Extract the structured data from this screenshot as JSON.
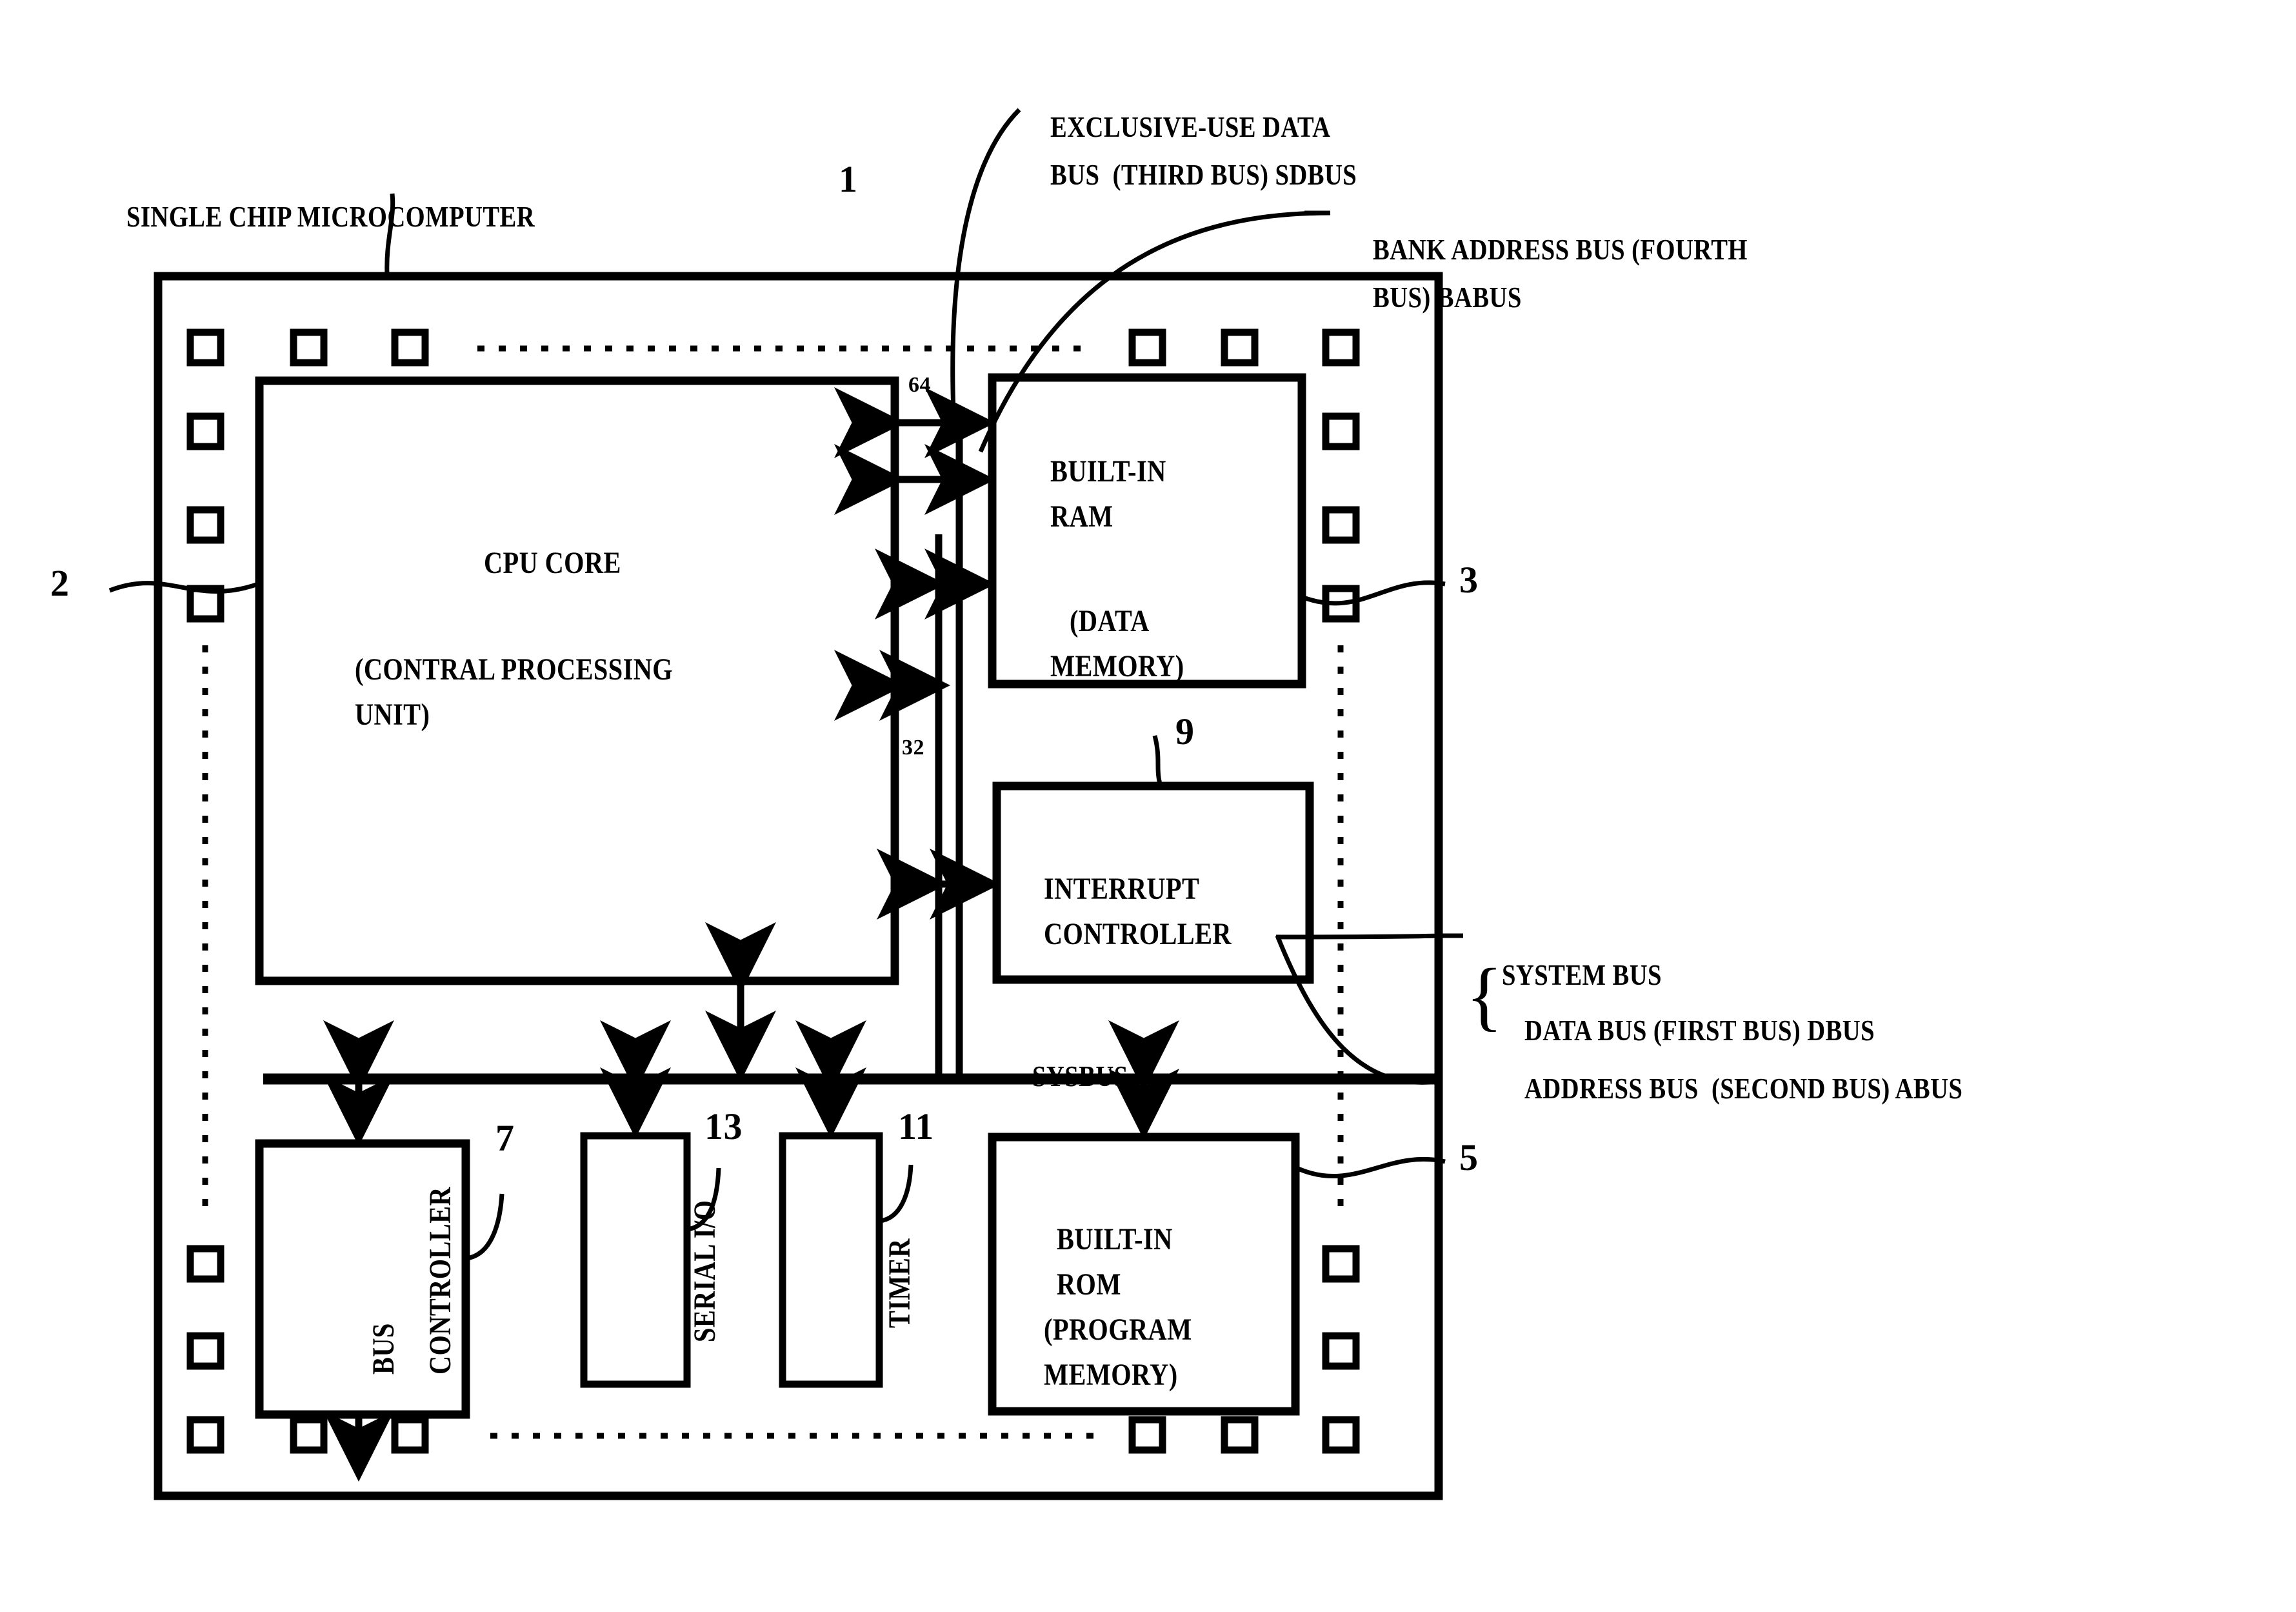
{
  "figure": {
    "title_label": "SINGLE CHIP MICROCOMPUTER",
    "title_ref": "1"
  },
  "annotations": {
    "sdbus": {
      "line1": "EXCLUSIVE-USE DATA",
      "line2": "BUS  (THIRD BUS) SDBUS"
    },
    "babus": {
      "line1": "BANK ADDRESS BUS (FOURTH",
      "line2": "BUS) BABUS"
    },
    "system_bus": {
      "heading": "SYSTEM BUS",
      "line1": "DATA BUS (FIRST BUS) DBUS",
      "line2": "ADDRESS BUS  (SECOND BUS) ABUS",
      "brace": "{"
    },
    "sysbus_label": "SYSBUS"
  },
  "blocks": {
    "cpu_core": {
      "line1": "CPU CORE",
      "line2": "(CONTRAL PROCESSING",
      "line3": "UNIT)",
      "ref": "2"
    },
    "builtin_ram": {
      "line1": "BUILT-IN",
      "line2": "RAM",
      "line3": "(DATA",
      "line4": "MEMORY)",
      "ref": "3"
    },
    "interrupt_controller": {
      "line1": "INTERRUPT",
      "line2": "CONTROLLER",
      "ref": "9"
    },
    "bus_controller": {
      "line1": "BUS",
      "line2": "CONTROLLER",
      "ref": "7"
    },
    "serial_io": {
      "line1": "SERIAL I/O",
      "ref": "13"
    },
    "timer": {
      "line1": "TIMER",
      "ref": "11"
    },
    "builtin_rom": {
      "line1": "BUILT-IN",
      "line2": "ROM",
      "line3": "(PROGRAM",
      "line4": "MEMORY)",
      "ref": "5"
    }
  },
  "bus_widths": {
    "ram_bus": "64",
    "system_bus": "32"
  },
  "colors": {
    "ink": "#000000",
    "paper": "#ffffff"
  }
}
